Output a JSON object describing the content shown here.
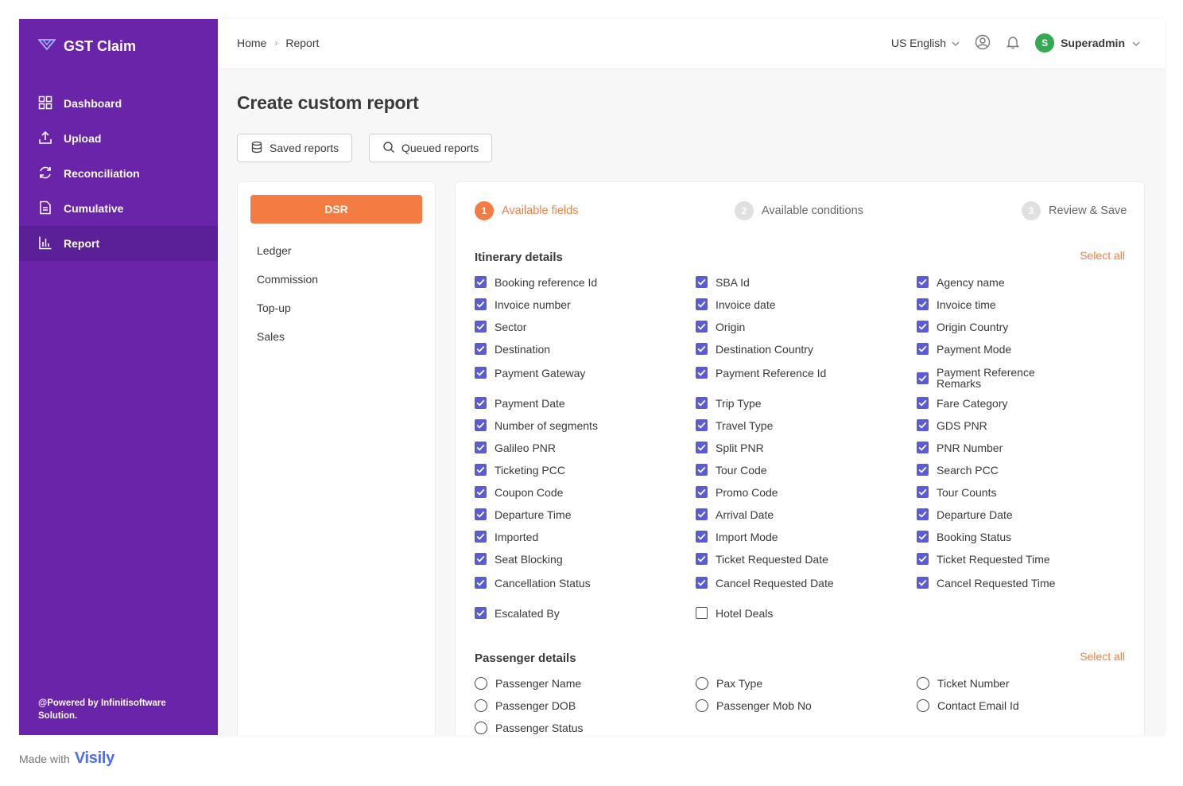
{
  "app": {
    "title": "GST Claim"
  },
  "sidebar": {
    "items": [
      {
        "label": "Dashboard",
        "icon": "dashboard-icon"
      },
      {
        "label": "Upload",
        "icon": "upload-icon"
      },
      {
        "label": "Reconciliation",
        "icon": "reconciliation-icon"
      },
      {
        "label": "Cumulative",
        "icon": "document-icon"
      },
      {
        "label": "Report",
        "icon": "bar-chart-icon",
        "active": true
      }
    ],
    "powered_by": "@Powered by Infinitisoftware Solution."
  },
  "header": {
    "breadcrumb": [
      "Home",
      "Report"
    ],
    "language": "US English",
    "user_initial": "S",
    "user_name": "Superadmin"
  },
  "page": {
    "title": "Create custom report",
    "saved_reports": "Saved reports",
    "queued_reports": "Queued reports"
  },
  "report_types": {
    "active": "DSR",
    "items": [
      "Ledger",
      "Commission",
      "Top-up",
      "Sales"
    ]
  },
  "steps": [
    {
      "num": "1",
      "label": "Available fields",
      "active": true
    },
    {
      "num": "2",
      "label": "Available conditions"
    },
    {
      "num": "3",
      "label": "Review & Save"
    }
  ],
  "sections": {
    "itinerary": {
      "title": "Itinerary details",
      "select_all": "Select all",
      "fields": [
        [
          "Booking reference Id",
          "SBA Id",
          "Agency name"
        ],
        [
          "Invoice number",
          "Invoice date",
          "Invoice time"
        ],
        [
          "Sector",
          "Origin",
          "Origin Country"
        ],
        [
          "Destination",
          "Destination Country",
          "Payment Mode"
        ],
        [
          "Payment Gateway",
          "Payment Reference Id",
          "Payment Reference Remarks"
        ],
        [
          "Payment Date",
          "Trip Type",
          "Fare Category"
        ],
        [
          "Number of segments",
          "Travel Type",
          "GDS PNR"
        ],
        [
          "Galileo PNR",
          "Split PNR",
          "PNR Number"
        ],
        [
          "Ticketing PCC",
          "Tour Code",
          "Search PCC"
        ],
        [
          "Coupon Code",
          "Promo Code",
          "Tour Counts"
        ],
        [
          "Departure Time",
          "Arrival Date",
          "Departure Date"
        ],
        [
          "Imported",
          "Import Mode",
          "Booking Status"
        ],
        [
          "Seat Blocking",
          "Ticket Requested Date",
          "Ticket Requested Time"
        ],
        [
          "Cancellation Status",
          "Cancel Requested Date",
          "Cancel Requested Time"
        ],
        [
          "Escalated By",
          "Hotel Deals"
        ]
      ],
      "unchecked": [
        "Hotel Deals"
      ]
    },
    "passenger": {
      "title": "Passenger details",
      "select_all": "Select all",
      "fields": [
        [
          "Passenger Name",
          "Pax Type",
          "Ticket Number"
        ],
        [
          "Passenger DOB",
          "Passenger Mob No",
          "Contact Email Id"
        ],
        [
          "Passenger Status"
        ]
      ]
    }
  },
  "footer": {
    "made_with": "Made with",
    "brand": "Visily"
  },
  "colors": {
    "sidebar": "#6a24a9",
    "accent": "#f47c42",
    "checkbox": "#5b5bd6"
  }
}
